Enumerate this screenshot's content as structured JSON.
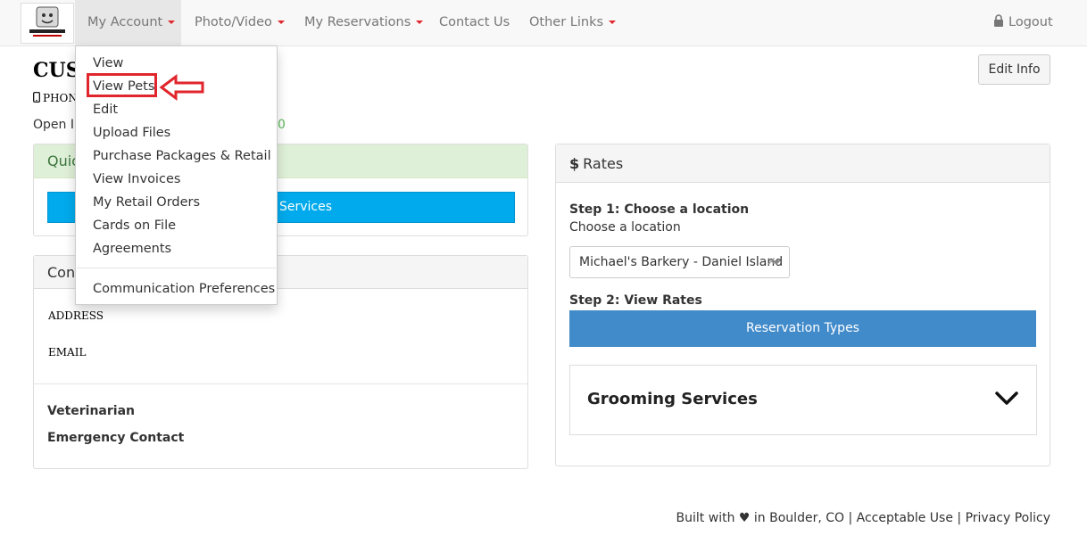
{
  "navbar": {
    "logo_alt": "Michael's Barkery",
    "items": [
      {
        "label": "My Account",
        "has_caret": true,
        "active": true
      },
      {
        "label": "Photo/Video",
        "has_caret": true
      },
      {
        "label": "My Reservations",
        "has_caret": true
      },
      {
        "label": "Contact Us",
        "has_caret": false
      },
      {
        "label": "Other Links",
        "has_caret": true
      }
    ],
    "logout_label": "Logout",
    "caret_color": "#e0262c"
  },
  "dropdown": {
    "items": [
      "View",
      "View Pets",
      "Edit",
      "Upload Files",
      "Purchase Packages & Retail",
      "View Invoices",
      "My Retail Orders",
      "Cards on File",
      "Agreements"
    ],
    "footer_item": "Communication Preferences",
    "highlighted_item": "View Pets",
    "annotation_color": "#e0262c"
  },
  "header": {
    "title_partial": "CUS",
    "phone_partial": "PHON",
    "open_line_partial": "Open In",
    "open_line_tail": "0",
    "edit_info_label": "Edit Info"
  },
  "quick_panel": {
    "heading_partial": "Quic",
    "button_partial": "Services",
    "heading_bg": "#dff0d8",
    "button_color": "#00aaec"
  },
  "contact_panel": {
    "heading_partial": "Cont",
    "address_label": "ADDRESS",
    "email_label": "EMAIL",
    "veterinarian_label": "Veterinarian",
    "emergency_label": "Emergency Contact"
  },
  "rates_panel": {
    "heading": "Rates",
    "step1_title": "Step 1: Choose a location",
    "step1_sub": "Choose a location",
    "location_selected": "Michael's Barkery - Daniel Island",
    "step2_title": "Step 2: View Rates",
    "reservation_types_label": "Reservation Types",
    "grooming_title": "Grooming Services",
    "button_color": "#428bca"
  },
  "footer": {
    "built_with_prefix": "Built with",
    "heart": "♥",
    "built_with_suffix": "in Boulder, CO",
    "separator": "|",
    "acceptable_use": "Acceptable Use",
    "privacy_policy": "Privacy Policy"
  }
}
